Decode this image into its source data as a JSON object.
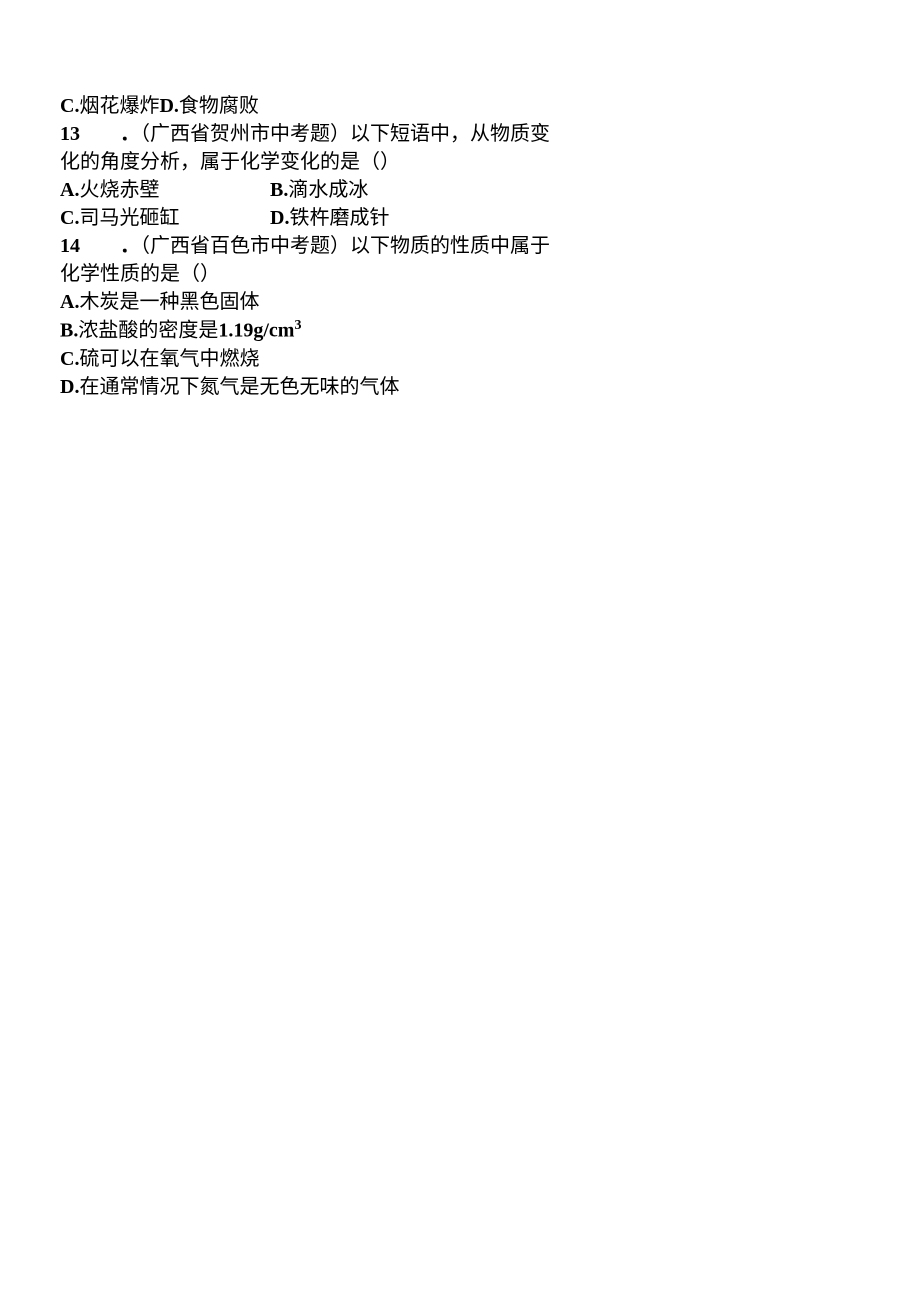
{
  "q12_options_cd": {
    "c_label": "C.",
    "c_text": "烟花爆炸",
    "d_label": "D.",
    "d_text": "食物腐败"
  },
  "q13": {
    "number": "13",
    "dot": "．",
    "stem_line1": "（广西省贺州市中考题）以下短语中，从物质变",
    "stem_line2": "化的角度分析，属于化学变化的是（）",
    "a_label": "A.",
    "a_text": "火烧赤壁",
    "b_label": "B.",
    "b_text": "滴水成冰",
    "c_label": "C.",
    "c_text": "司马光砸缸",
    "d_label": "D.",
    "d_text": "铁杵磨成针"
  },
  "q14": {
    "number": "14",
    "dot": "．",
    "stem_line1": "（广西省百色市中考题）以下物质的性质中属于",
    "stem_line2": "化学性质的是（）",
    "a_label": "A.",
    "a_text": "木炭是一种黑色固体",
    "b_label": "B.",
    "b_text_pre": "浓盐酸的密度是",
    "b_value": "1.19g/cm",
    "b_sup": "3",
    "c_label": "C.",
    "c_text": "硫可以在氧气中燃烧",
    "d_label": "D.",
    "d_text": "在通常情况下氮气是无色无味的气体"
  }
}
